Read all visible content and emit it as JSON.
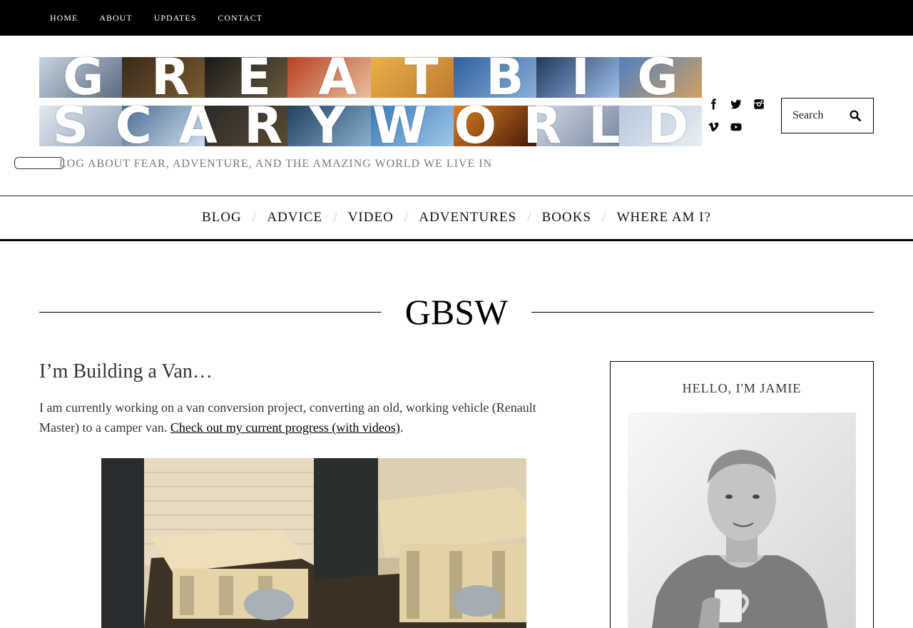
{
  "top_nav": {
    "items": [
      {
        "label": "HOME"
      },
      {
        "label": "ABOUT"
      },
      {
        "label": "UPDATES"
      },
      {
        "label": "CONTACT"
      }
    ]
  },
  "banner": {
    "line1": [
      "G",
      "R",
      "E",
      "A",
      "T",
      "B",
      "I",
      "G"
    ],
    "line2": [
      "S",
      "C",
      "A",
      "R",
      "Y",
      "W",
      "O",
      "R",
      "L",
      "D"
    ]
  },
  "header": {
    "tagline": "LOG ABOUT FEAR, ADVENTURE, AND THE AMAZING WORLD WE LIVE IN"
  },
  "social": {
    "icons": [
      "facebook-icon",
      "twitter-icon",
      "instagram-icon",
      "vimeo-icon",
      "youtube-icon"
    ]
  },
  "search": {
    "placeholder": "Search"
  },
  "main_nav": {
    "items": [
      {
        "label": "BLOG"
      },
      {
        "label": "ADVICE"
      },
      {
        "label": "VIDEO"
      },
      {
        "label": "ADVENTURES"
      },
      {
        "label": "BOOKS"
      },
      {
        "label": "WHERE AM I?"
      }
    ],
    "separator": "/"
  },
  "site": {
    "title": "GBSW"
  },
  "post": {
    "title": "I’m Building a Van…",
    "body_text": "I am currently working on a van conversion project, converting an old, working vehicle (Renault Master) to a camper van. ",
    "link_text": "Check out my current progress (with videos)",
    "body_end": "."
  },
  "sidebar": {
    "widget_title": "HELLO, I'M JAMIE"
  },
  "colors": {
    "topbar_bg": "#000000",
    "text": "#222222",
    "tagline": "#777777",
    "separator": "#cccccc"
  }
}
